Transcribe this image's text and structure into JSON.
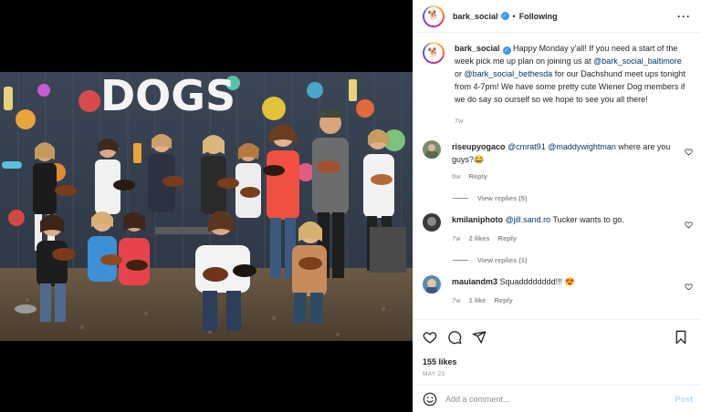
{
  "post": {
    "author": "bark_social",
    "follow_status": "Following",
    "caption_author": "bark_social",
    "caption": {
      "t1": "Happy Monday y'all! If you need a start of the week pick me up plan on joining us at ",
      "m1": "@bark_social_baltimore",
      "t2": " or ",
      "m2": "@bark_social_bethesda",
      "t3": " for our Dachshund meet ups tonight from 4-7pm! We have some pretty cute Wiener Dog members if we do say so ourself so we hope to see you all there!"
    },
    "caption_age": "7w"
  },
  "comments": [
    {
      "username": "riseupyogaco",
      "mention1": "@cmrat91",
      "mention2": "@maddywightman",
      "text": " where are you guys?😂",
      "age": "6w",
      "reply_label": "Reply",
      "view_replies": "View replies (5)"
    },
    {
      "username": "kmilaniphoto",
      "mention1": "@jill.sand.ro",
      "text": " Tucker wants to go.",
      "age": "7w",
      "likes": "2 likes",
      "reply_label": "Reply",
      "view_replies": "View replies (1)"
    },
    {
      "username": "mauiandm3",
      "text": "Squadddddddd!!! 😍",
      "age": "7w",
      "likes": "1 like",
      "reply_label": "Reply"
    }
  ],
  "engagement": {
    "likes": "155 likes",
    "date": "MAY 23"
  },
  "composer": {
    "placeholder": "Add a comment...",
    "post_label": "Post"
  },
  "photo": {
    "sign_text": "DOGS"
  },
  "icons": {
    "more": "more-options-icon",
    "like": "heart-icon",
    "comment": "comment-icon",
    "share": "share-icon",
    "save": "bookmark-icon",
    "emoji": "emoji-icon"
  },
  "colors": {
    "link": "#00376b",
    "verified": "#3897f0",
    "muted": "#8e8e8e",
    "post_button": "#b3dbff"
  }
}
